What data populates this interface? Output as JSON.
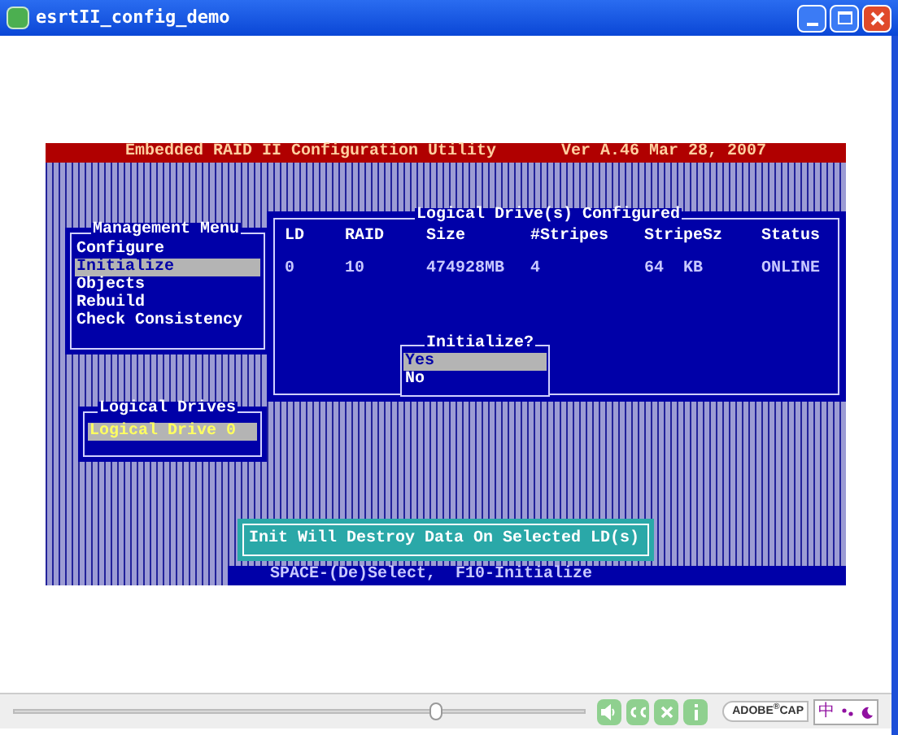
{
  "window": {
    "title": "esrtII_config_demo"
  },
  "utility_header": {
    "title": "Embedded RAID II Configuration Utility",
    "version": "Ver A.46 Mar 28, 2007"
  },
  "management_menu": {
    "title": "Management Menu",
    "items": [
      {
        "label": "Configure",
        "selected": false
      },
      {
        "label": "Initialize",
        "selected": true
      },
      {
        "label": "Objects",
        "selected": false
      },
      {
        "label": "Rebuild",
        "selected": false
      },
      {
        "label": "Check Consistency",
        "selected": false
      }
    ]
  },
  "logical_drives_panel": {
    "title": "Logical Drives",
    "items": [
      {
        "label": "Logical Drive 0",
        "selected": true
      }
    ]
  },
  "configured_table": {
    "title": "Logical Drive(s) Configured",
    "columns": [
      "LD",
      "RAID",
      "Size",
      "#Stripes",
      "StripeSz",
      "Status"
    ],
    "rows": [
      [
        "0",
        "10",
        "474928MB",
        "4",
        "64  KB",
        "ONLINE"
      ]
    ]
  },
  "initialize_dialog": {
    "title": "Initialize?",
    "options": [
      {
        "label": "Yes",
        "selected": true
      },
      {
        "label": "No",
        "selected": false
      }
    ]
  },
  "message": "Init Will Destroy Data On Selected LD(s)",
  "key_hints": "SPACE-(De)Select,  F10-Initialize",
  "player_bar": {
    "progress": {
      "level": 0.74
    },
    "brand": "ADOBE$^{®}$CAP"
  },
  "ime_bar": {
    "mode": "中"
  }
}
